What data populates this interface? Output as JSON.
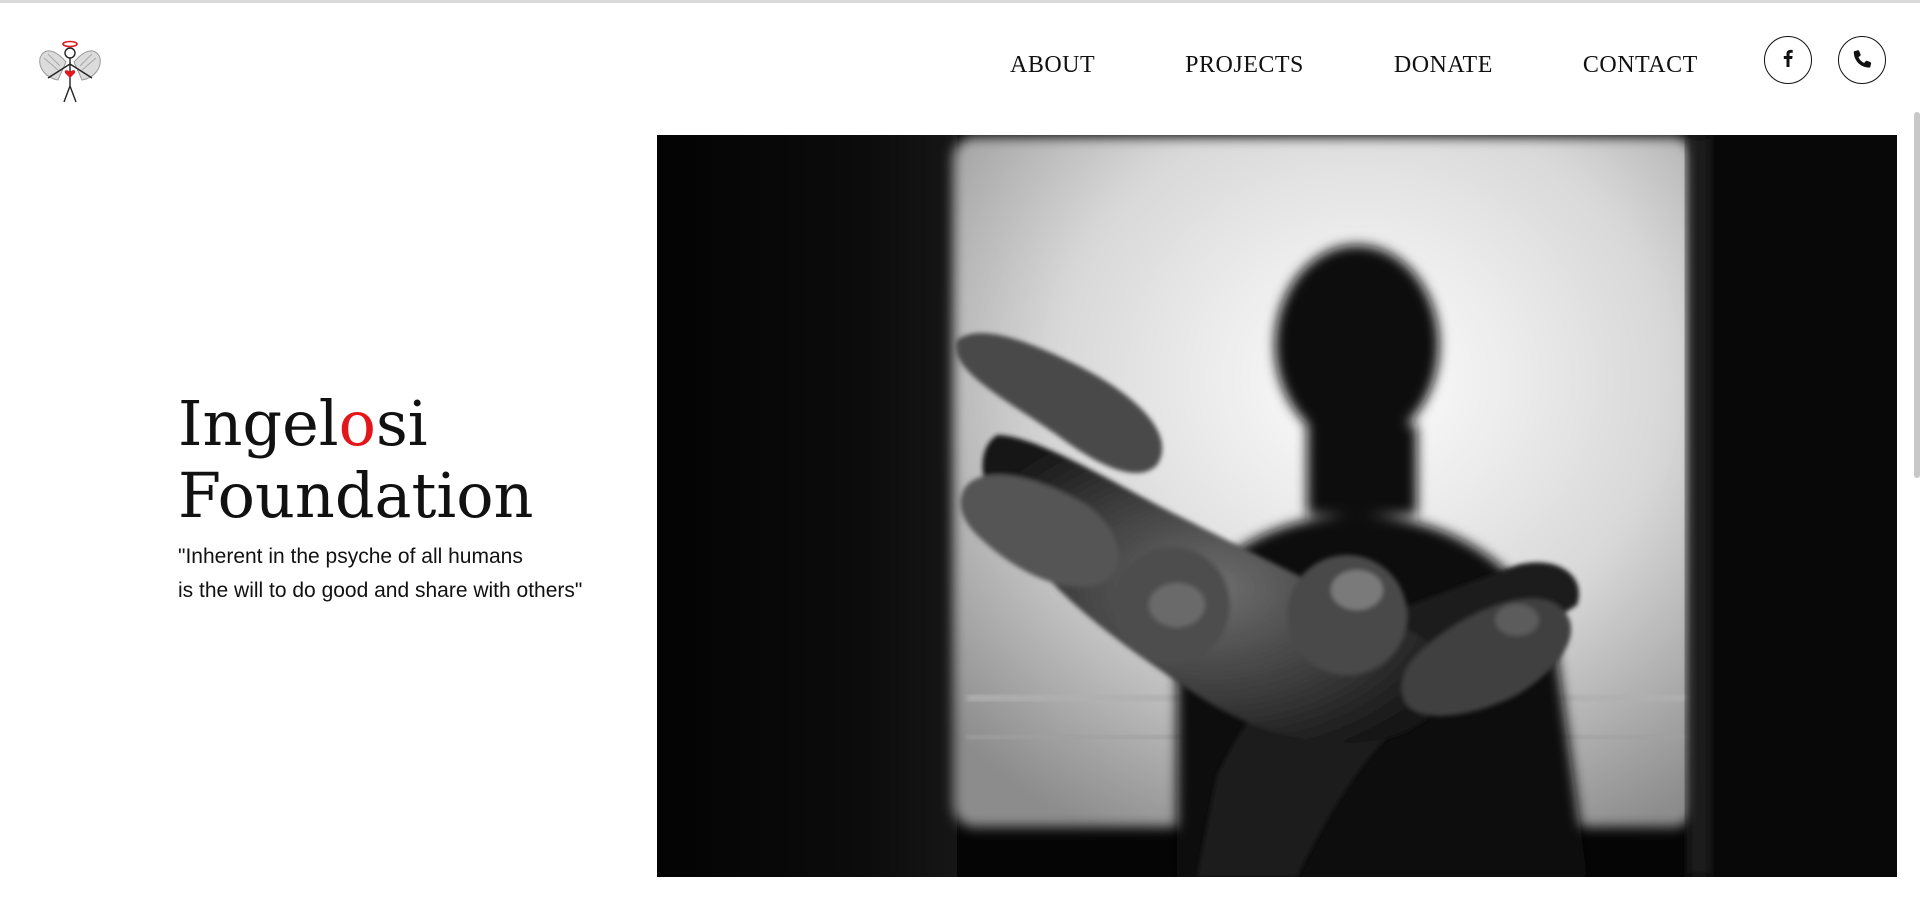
{
  "site": {
    "logo_icon": "angel-logo-icon",
    "nav": [
      {
        "label": "ABOUT"
      },
      {
        "label": "PROJECTS"
      },
      {
        "label": "DONATE"
      },
      {
        "label": "CONTACT"
      }
    ],
    "social": [
      {
        "icon": "facebook-icon"
      },
      {
        "icon": "phone-icon"
      }
    ]
  },
  "hero": {
    "title_part1": "Ingel",
    "title_accent": "o",
    "title_part2": "si",
    "title_line2": "Foundation",
    "quote_line1": "\"Inherent in the psyche of all humans",
    "quote_line2": "is the will to do good and share with others\"",
    "image_icon": "outstretched-hand-photo"
  },
  "colors": {
    "accent": "#e2161b",
    "text": "#111111",
    "background": "#ffffff"
  }
}
